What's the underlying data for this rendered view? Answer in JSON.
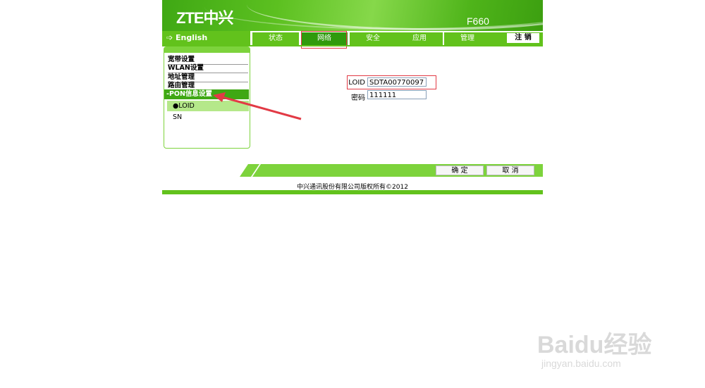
{
  "header": {
    "logo": "ZTE中兴",
    "model": "F660"
  },
  "nav": {
    "language": "English",
    "tabs": [
      {
        "label": "状态"
      },
      {
        "label": "网络"
      },
      {
        "label": "安全"
      },
      {
        "label": "应用"
      },
      {
        "label": "管理"
      }
    ],
    "active_tab": "网络",
    "logout": "注 销"
  },
  "sidebar": {
    "items": [
      "宽带设置",
      "WLAN设置",
      "地址管理",
      "路由管理"
    ],
    "active_item": "-PON信息设置",
    "sub_items": [
      {
        "label": "LOID",
        "selected": true
      },
      {
        "label": "SN",
        "selected": false
      }
    ]
  },
  "form": {
    "loid_label": "LOID",
    "loid_value": "SDTA00770097",
    "password_label": "密码",
    "password_value": "111111"
  },
  "actions": {
    "confirm": "确 定",
    "cancel": "取 消"
  },
  "footer": {
    "copyright": "中兴通讯股份有限公司版权所有©2012"
  },
  "watermark": {
    "brand": "Baidu经验",
    "url": "jingyan.baidu.com"
  },
  "colors": {
    "green": "#62c21c",
    "dark_green": "#3fa814",
    "highlight_red": "#e23a45"
  }
}
